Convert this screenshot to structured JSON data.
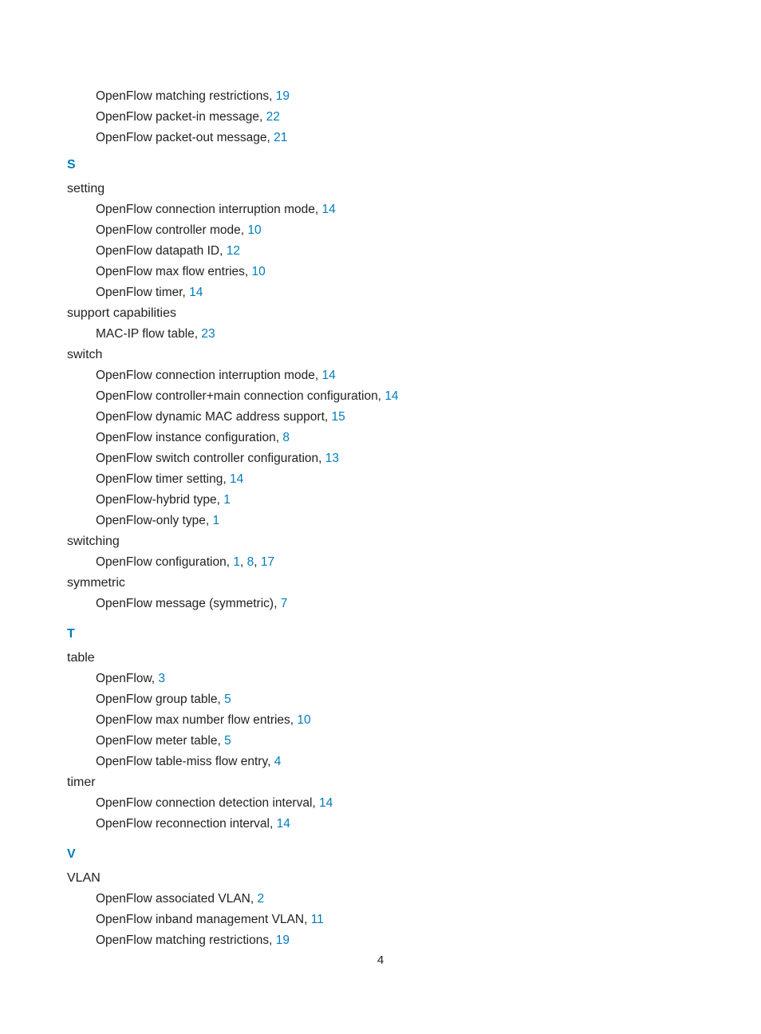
{
  "orphan_subs": [
    {
      "text": "OpenFlow matching restrictions, ",
      "pages": [
        "19"
      ]
    },
    {
      "text": "OpenFlow packet-in message, ",
      "pages": [
        "22"
      ]
    },
    {
      "text": "OpenFlow packet-out message, ",
      "pages": [
        "21"
      ]
    }
  ],
  "sections": [
    {
      "letter": "S",
      "groups": [
        {
          "term": "setting",
          "subs": [
            {
              "text": "OpenFlow connection interruption mode, ",
              "pages": [
                "14"
              ]
            },
            {
              "text": "OpenFlow controller mode, ",
              "pages": [
                "10"
              ]
            },
            {
              "text": "OpenFlow datapath ID, ",
              "pages": [
                "12"
              ]
            },
            {
              "text": "OpenFlow max flow entries, ",
              "pages": [
                "10"
              ]
            },
            {
              "text": "OpenFlow timer, ",
              "pages": [
                "14"
              ]
            }
          ]
        },
        {
          "term": "support capabilities",
          "subs": [
            {
              "text": "MAC-IP flow table, ",
              "pages": [
                "23"
              ]
            }
          ]
        },
        {
          "term": "switch",
          "subs": [
            {
              "text": "OpenFlow connection interruption mode, ",
              "pages": [
                "14"
              ]
            },
            {
              "text": "OpenFlow controller+main connection configuration, ",
              "pages": [
                "14"
              ]
            },
            {
              "text": "OpenFlow dynamic MAC address support, ",
              "pages": [
                "15"
              ]
            },
            {
              "text": "OpenFlow instance configuration, ",
              "pages": [
                "8"
              ]
            },
            {
              "text": "OpenFlow switch controller configuration, ",
              "pages": [
                "13"
              ]
            },
            {
              "text": "OpenFlow timer setting, ",
              "pages": [
                "14"
              ]
            },
            {
              "text": "OpenFlow-hybrid type, ",
              "pages": [
                "1"
              ]
            },
            {
              "text": "OpenFlow-only type, ",
              "pages": [
                "1"
              ]
            }
          ]
        },
        {
          "term": "switching",
          "subs": [
            {
              "text": "OpenFlow configuration, ",
              "pages": [
                "1",
                "8",
                "17"
              ]
            }
          ]
        },
        {
          "term": "symmetric",
          "subs": [
            {
              "text": "OpenFlow message (symmetric), ",
              "pages": [
                "7"
              ]
            }
          ]
        }
      ]
    },
    {
      "letter": "T",
      "groups": [
        {
          "term": "table",
          "subs": [
            {
              "text": "OpenFlow, ",
              "pages": [
                "3"
              ]
            },
            {
              "text": "OpenFlow group table, ",
              "pages": [
                "5"
              ]
            },
            {
              "text": "OpenFlow max number flow entries, ",
              "pages": [
                "10"
              ]
            },
            {
              "text": "OpenFlow meter table, ",
              "pages": [
                "5"
              ]
            },
            {
              "text": "OpenFlow table-miss flow entry, ",
              "pages": [
                "4"
              ]
            }
          ]
        },
        {
          "term": "timer",
          "subs": [
            {
              "text": "OpenFlow connection detection interval, ",
              "pages": [
                "14"
              ]
            },
            {
              "text": "OpenFlow reconnection interval, ",
              "pages": [
                "14"
              ]
            }
          ]
        }
      ]
    },
    {
      "letter": "V",
      "groups": [
        {
          "term": "VLAN",
          "subs": [
            {
              "text": "OpenFlow associated VLAN, ",
              "pages": [
                "2"
              ]
            },
            {
              "text": "OpenFlow inband management VLAN, ",
              "pages": [
                "11"
              ]
            },
            {
              "text": "OpenFlow matching restrictions, ",
              "pages": [
                "19"
              ]
            }
          ]
        }
      ]
    }
  ],
  "page_number": "4"
}
